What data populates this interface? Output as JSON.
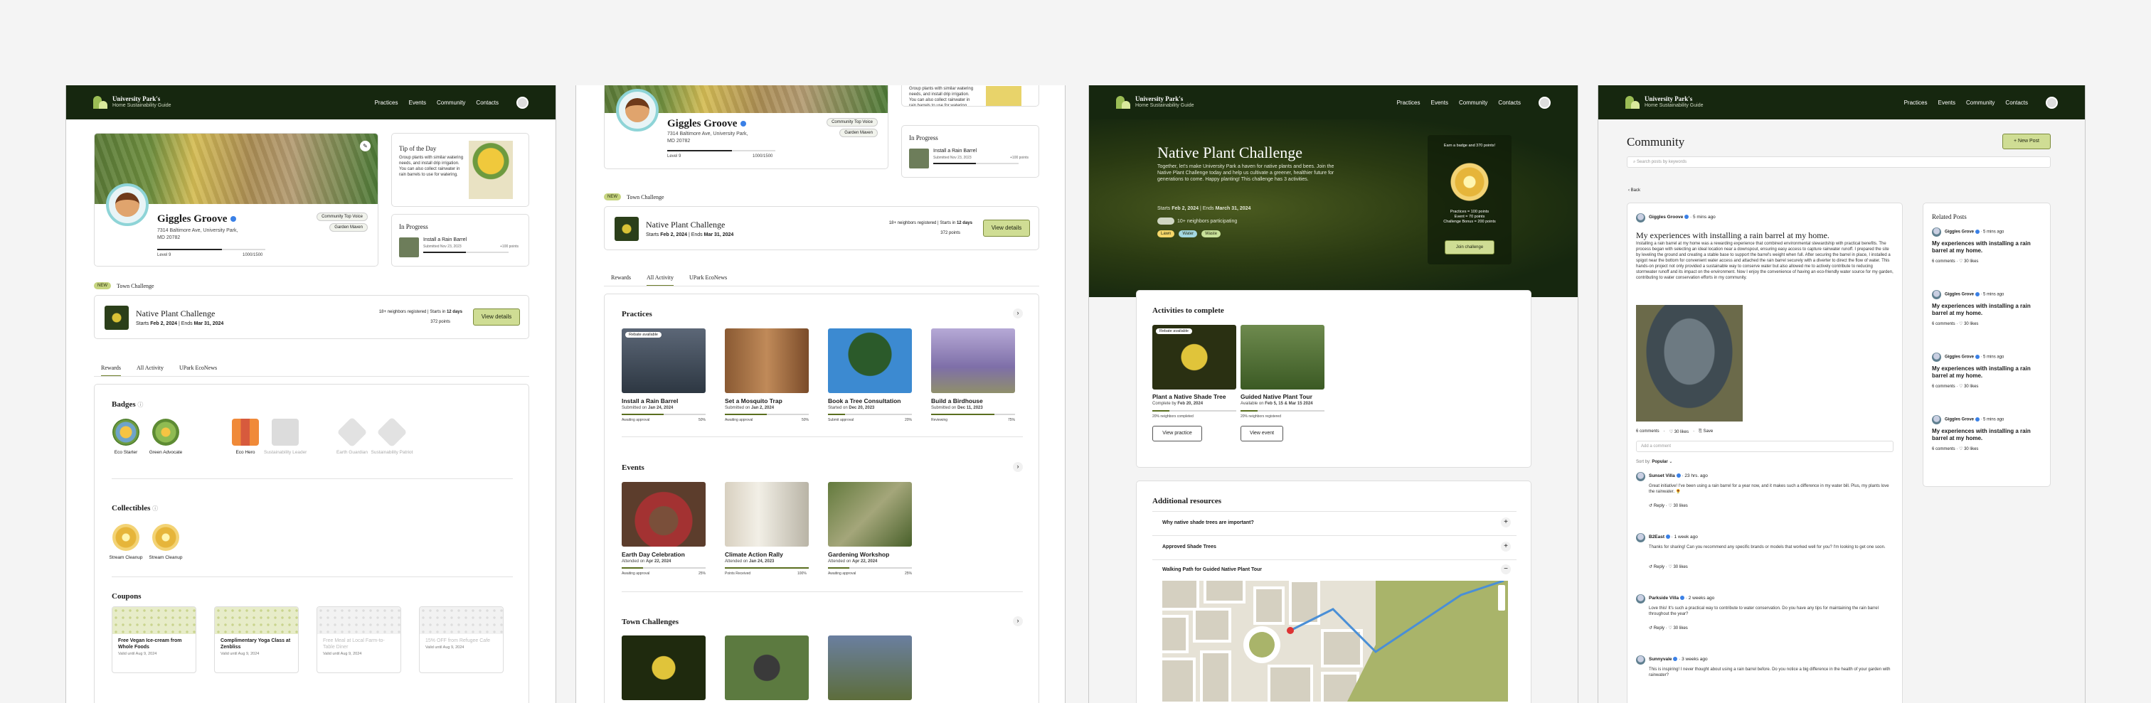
{
  "brand": {
    "name": "University Park's",
    "tagline": "Home Sustainability Guide"
  },
  "nav": [
    "Practices",
    "Events",
    "Community",
    "Contacts"
  ],
  "profile": {
    "name": "Giggles Groove",
    "address1": "7314 Baltimore Ave, University Park,",
    "address2": "MD 20782",
    "address_inline": "7314 Baltimore Ave, University Park,",
    "level": "Level 9",
    "points": "1000/1500",
    "level_fraction": 0.6,
    "badges": [
      "Community Top Voice",
      "Garden Maven"
    ]
  },
  "tip": {
    "title": "Tip of the Day",
    "text": "Group plants with similar watering needs, and install drip irrigation. You can also collect rainwater in rain barrels to use for watering."
  },
  "in_progress": {
    "title": "In Progress",
    "item": "Install a Rain Barrel",
    "date": "Submitted Nov 23, 2023",
    "points": "+100 points",
    "fraction": 0.5
  },
  "town_challenge": {
    "tag": "NEW",
    "label": "Town Challenge",
    "title": "Native Plant Challenge",
    "starts_label": "Starts",
    "starts": "Feb 2, 2024",
    "ends_label": "Ends",
    "ends": "Mar 31, 2024",
    "dates_sep": " | ",
    "registered": "18+ neighbors registered",
    "starts_in": " | Starts in ",
    "starts_in_val": "12 days",
    "points": "372 points",
    "cta": "View details"
  },
  "tabs": [
    "Rewards",
    "All Activity",
    "UPark EcoNews"
  ],
  "rewards": {
    "badges_title": "Badges",
    "badges": [
      {
        "name": "Eco Starter",
        "earned": true
      },
      {
        "name": "Green Advocate",
        "earned": true
      },
      {
        "name": "Eco Hero",
        "earned": true
      },
      {
        "name": "Sustainability Leader",
        "earned": false
      },
      {
        "name": "Earth Guardian",
        "earned": false
      },
      {
        "name": "Sustainability Patriot",
        "earned": false
      }
    ],
    "collectibles_title": "Collectibles",
    "collectibles": [
      "Stream Cleanup",
      "Stream Cleanup"
    ],
    "coupons_title": "Coupons",
    "coupons": [
      {
        "title": "Free Vegan Ice-cream from Whole Foods",
        "valid": "Valid until Aug 9, 2024",
        "active": true
      },
      {
        "title": "Complimentary Yoga Class at Zenbliss",
        "valid": "Valid until Aug 9, 2024",
        "active": true
      },
      {
        "title": "Free Meal at Local Farm-to-Table Diner",
        "valid": "Valid until Aug 9, 2024",
        "active": false
      },
      {
        "title": "15% OFF from Refugee Cafe",
        "valid": "Valid until Aug 9, 2024",
        "active": false
      }
    ]
  },
  "activity": {
    "practices_title": "Practices",
    "practices": [
      {
        "title": "Install a Rain Barrel",
        "sub_label": "Submitted on ",
        "sub_date": "Jan 24, 2024",
        "status": "Awaiting approval",
        "pct": "50%",
        "fraction": 0.5,
        "chip": "Rebate available"
      },
      {
        "title": "Set a Mosquito Trap",
        "sub_label": "Submitted on ",
        "sub_date": "Jan 2, 2024",
        "status": "Awaiting approval",
        "pct": "50%",
        "fraction": 0.5
      },
      {
        "title": "Book a Tree Consultation",
        "sub_label": "Started on ",
        "sub_date": "Dec 20, 2023",
        "status": "Submit approval",
        "pct": "20%",
        "fraction": 0.2
      },
      {
        "title": "Build a Birdhouse",
        "sub_label": "Submitted on ",
        "sub_date": "Dec 11, 2023",
        "status": "Reviewing",
        "pct": "75%",
        "fraction": 0.75
      }
    ],
    "events_title": "Events",
    "events": [
      {
        "title": "Earth Day Celebration",
        "sub_label": "Attended on ",
        "sub_date": "Apr 22, 2024",
        "status": "Awaiting approval",
        "pct": "25%",
        "fraction": 0.25
      },
      {
        "title": "Climate Action Rally",
        "sub_label": "Attended on ",
        "sub_date": "Jan 24, 2023",
        "status": "Points Received",
        "pct": "100%",
        "fraction": 1.0
      },
      {
        "title": "Gardening Workshop",
        "sub_label": "Attended on ",
        "sub_date": "Apr 22, 2024",
        "status": "Awaiting approval",
        "pct": "25%",
        "fraction": 0.25
      }
    ],
    "challenges_title": "Town Challenges"
  },
  "challenge_page": {
    "title": "Native Plant Challenge",
    "desc": "Together, let's make University Park a haven for native plants and bees. Join the Native Plant Challenge today and help us cultivate a greener, healthier future for generations to come. Happy planting! This challenge has 3 activities.",
    "starts": "Feb 2, 2024",
    "ends": "March 31, 2024",
    "participating": "10+ neighbors participating",
    "chips": [
      "Lawn",
      "Water",
      "Waste"
    ],
    "earn": "Earn a badge and 370 points!",
    "practices": "Practices = 100 points",
    "event": "Event = 70 points",
    "bonus": "Challenge Bonus = 200 points",
    "cta": "Join challenge",
    "activities_title": "Activities to complete",
    "activities": [
      {
        "title": "Plant a Native Shade Tree",
        "sub_label": "Complete by ",
        "sub_date": "Feb 20, 2024",
        "status": "20% neighbors completed",
        "fraction": 0.2,
        "cta": "View practice",
        "chip": "Rebate available"
      },
      {
        "title": "Guided Native Plant Tour",
        "sub_label": "Available on ",
        "sub_date": "Feb 5, 15 & Mar 15 2024",
        "status": "20% neighbors registered",
        "fraction": 0.2,
        "cta": "View event"
      }
    ],
    "resources_title": "Additional resources",
    "resources": [
      "Why native shade trees are important?",
      "Approved Shade Trees",
      "Walking Path for Guided Native Plant Tour"
    ]
  },
  "community": {
    "title": "Community",
    "new_post": "New Post",
    "search": "Search posts by keywords",
    "back": "Back",
    "post": {
      "author": "Giggles Groove",
      "time": "5 mins ago",
      "title": "My experiences with installing a rain barrel at my home.",
      "body": "Installing a rain barrel at my home was a rewarding experience that combined environmental stewardship with practical benefits. The process began with selecting an ideal location near a downspout, ensuring easy access to capture rainwater runoff. I prepared the site by leveling the ground and creating a stable base to support the barrel's weight when full. After securing the barrel in place, I installed a spigot near the bottom for convenient water access and attached the rain barrel securely with a diverter to direct the flow of water. This hands-on project not only provided a sustainable way to conserve water but also allowed me to actively contribute to reducing stormwater runoff and its impact on the environment. Now I enjoy the convenience of having an eco-friendly water source for my garden, contributing to water conservation efforts in my community.",
      "comments": "6 comments",
      "likes": "30 likes",
      "save": "Save",
      "add": "Add a comment",
      "sort_label": "Sort by:",
      "sort": "Popular"
    },
    "comments": [
      {
        "author": "Sunset Villa",
        "time": "23 hrs. ago",
        "text": "Great initiative! I've been using a rain barrel for a year now, and it makes such a difference in my water bill. Plus, my plants love the rainwater. 🌻"
      },
      {
        "author": "B2East",
        "time": "1 week ago",
        "text": "Thanks for sharing! Can you recommend any specific brands or models that worked well for you? I'm looking to get one soon."
      },
      {
        "author": "Parkside Villa",
        "time": "2 weeks ago",
        "text": "Love this! It's such a practical way to contribute to water conservation. Do you have any tips for maintaining the rain barrel throughout the year?"
      },
      {
        "author": "Sunnyvale",
        "time": "3 weeks ago",
        "text": "This is inspiring! I never thought about using a rain barrel before. Do you notice a big difference in the health of your garden with rainwater?"
      }
    ],
    "reply": "Reply",
    "likes_c": "30 likes",
    "related_title": "Related Posts",
    "related": {
      "author": "Giggles Grove",
      "time": "5 mins ago",
      "title": "My experiences with installing a rain barrel at my home.",
      "comments": "6 comments",
      "likes": "30 likes"
    }
  },
  "colors": {
    "nav": "#16270f",
    "accent": "#cfdd94",
    "hero": "#1e3212"
  }
}
